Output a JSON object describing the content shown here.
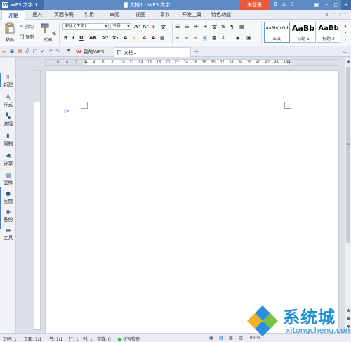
{
  "titlebar": {
    "app_name": "WPS 文字",
    "doc_title": "文档1 - WPS 文字",
    "login": "未登录"
  },
  "menu": {
    "tabs": [
      "开始",
      "插入",
      "页面布局",
      "引用",
      "审阅",
      "视图",
      "章节",
      "开发工具",
      "特色功能"
    ],
    "active": "开始"
  },
  "ribbon": {
    "paste": "粘贴",
    "cut": "剪切",
    "copy": "复制",
    "format_painter": "格式刷",
    "font_family": "宋体 (正文)",
    "font_size": "五号",
    "styles": [
      {
        "sample": "AaBbCcDd",
        "name": "正文"
      },
      {
        "sample": "AaBb",
        "name": "标题 1"
      },
      {
        "sample": "AaBb",
        "name": "标题 2"
      }
    ]
  },
  "doc_tabs": {
    "my_wps": "我的WPS",
    "doc1": "文档1"
  },
  "sidebar": {
    "items": [
      "新建",
      "样式",
      "选择",
      "限制",
      "分享",
      "属性",
      "反馈",
      "备份",
      "工具"
    ]
  },
  "ruler": {
    "marks": [
      "6",
      "4",
      "2",
      "2",
      "4",
      "6",
      "8",
      "10",
      "12",
      "14",
      "16",
      "18",
      "20",
      "22",
      "24",
      "26",
      "28",
      "30",
      "32",
      "34",
      "36",
      "38",
      "40",
      "42",
      "44",
      "46"
    ]
  },
  "status": {
    "page_num": "页码: 1",
    "page": "页面: 1/1",
    "section": "节: 1/1",
    "row": "行: 1",
    "col": "列: 1",
    "words": "字数: 0",
    "spellcheck": "拼写检查",
    "zoom": "90 %"
  },
  "watermark": {
    "text": "系统城",
    "url": "xitongcheng.com"
  },
  "colors": {
    "titlebar": "#5d8bc6",
    "login": "#e85b3a",
    "accent": "#4f7fc0"
  }
}
